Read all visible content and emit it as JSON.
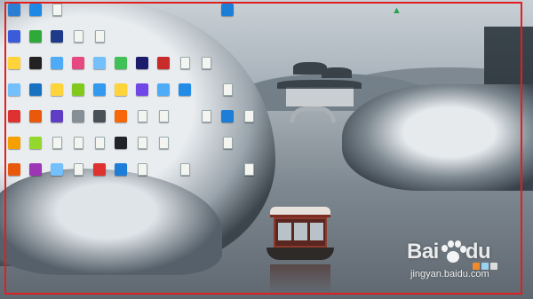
{
  "desktop": {
    "icons": [
      {
        "name": "desktop-icon-1",
        "glyph": "",
        "label": "",
        "color": "#2a7fd4",
        "col": 0,
        "row": 0
      },
      {
        "name": "desktop-icon-2",
        "glyph": "",
        "label": "",
        "color": "#1e88e5",
        "col": 1,
        "row": 0
      },
      {
        "name": "desktop-icon-3",
        "glyph": "",
        "label": "",
        "color": "doc",
        "col": 2,
        "row": 0
      },
      {
        "name": "desktop-icon-4",
        "glyph": "",
        "label": "",
        "color": "#3b5bdb",
        "col": 0,
        "row": 1
      },
      {
        "name": "desktop-icon-5",
        "glyph": "",
        "label": "",
        "color": "#2faa3a",
        "col": 1,
        "row": 1
      },
      {
        "name": "desktop-icon-6",
        "glyph": "",
        "label": "",
        "color": "#1e3a8a",
        "col": 2,
        "row": 1
      },
      {
        "name": "desktop-icon-7",
        "glyph": "",
        "label": "",
        "color": "doc",
        "col": 3,
        "row": 1
      },
      {
        "name": "desktop-icon-8",
        "glyph": "",
        "label": "",
        "color": "doc",
        "col": 4,
        "row": 1
      },
      {
        "name": "desktop-icon-9",
        "glyph": "",
        "label": "",
        "color": "#ffd43b",
        "col": 0,
        "row": 2
      },
      {
        "name": "desktop-icon-10",
        "glyph": "",
        "label": "",
        "color": "#222222",
        "col": 1,
        "row": 2
      },
      {
        "name": "desktop-icon-11",
        "glyph": "",
        "label": "",
        "color": "#4dabf7",
        "col": 2,
        "row": 2
      },
      {
        "name": "desktop-icon-12",
        "glyph": "",
        "label": "",
        "color": "#e64980",
        "col": 3,
        "row": 2
      },
      {
        "name": "desktop-icon-13",
        "glyph": "",
        "label": "",
        "color": "#74c0fc",
        "col": 4,
        "row": 2
      },
      {
        "name": "desktop-icon-14",
        "glyph": "",
        "label": "",
        "color": "#40c057",
        "col": 5,
        "row": 2
      },
      {
        "name": "desktop-icon-15",
        "glyph": "",
        "label": "",
        "color": "#1c1c6b",
        "col": 6,
        "row": 2
      },
      {
        "name": "desktop-icon-16",
        "glyph": "",
        "label": "",
        "color": "#c92a2a",
        "col": 7,
        "row": 2
      },
      {
        "name": "desktop-icon-17",
        "glyph": "",
        "label": "",
        "color": "doc",
        "col": 8,
        "row": 2
      },
      {
        "name": "desktop-icon-18",
        "glyph": "",
        "label": "",
        "color": "doc",
        "col": 9,
        "row": 2
      },
      {
        "name": "desktop-icon-19",
        "glyph": "",
        "label": "",
        "color": "#74c0fc",
        "col": 0,
        "row": 3
      },
      {
        "name": "desktop-icon-20",
        "glyph": "",
        "label": "",
        "color": "#1971c2",
        "col": 1,
        "row": 3
      },
      {
        "name": "desktop-icon-21",
        "glyph": "",
        "label": "",
        "color": "#ffd43b",
        "col": 2,
        "row": 3
      },
      {
        "name": "desktop-icon-22",
        "glyph": "",
        "label": "",
        "color": "#82c91e",
        "col": 3,
        "row": 3
      },
      {
        "name": "desktop-icon-23",
        "glyph": "",
        "label": "",
        "color": "#339af0",
        "col": 4,
        "row": 3
      },
      {
        "name": "desktop-icon-24",
        "glyph": "",
        "label": "",
        "color": "#ffd43b",
        "col": 5,
        "row": 3
      },
      {
        "name": "desktop-icon-25",
        "glyph": "",
        "label": "",
        "color": "#7048e8",
        "col": 6,
        "row": 3
      },
      {
        "name": "desktop-icon-26",
        "glyph": "",
        "label": "",
        "color": "#4dabf7",
        "col": 7,
        "row": 3
      },
      {
        "name": "desktop-icon-27",
        "glyph": "",
        "label": "",
        "color": "#228be6",
        "col": 8,
        "row": 3
      },
      {
        "name": "desktop-icon-28",
        "glyph": "",
        "label": "",
        "color": "doc",
        "col": 10,
        "row": 3
      },
      {
        "name": "desktop-icon-29",
        "glyph": "",
        "label": "",
        "color": "#e03131",
        "col": 0,
        "row": 4
      },
      {
        "name": "desktop-icon-30",
        "glyph": "",
        "label": "",
        "color": "#e8590c",
        "col": 1,
        "row": 4
      },
      {
        "name": "desktop-icon-31",
        "glyph": "",
        "label": "",
        "color": "#5f3dc4",
        "col": 2,
        "row": 4
      },
      {
        "name": "desktop-icon-32",
        "glyph": "",
        "label": "",
        "color": "#868e96",
        "col": 3,
        "row": 4
      },
      {
        "name": "desktop-icon-33",
        "glyph": "",
        "label": "",
        "color": "#495057",
        "col": 4,
        "row": 4
      },
      {
        "name": "desktop-icon-34",
        "glyph": "",
        "label": "",
        "color": "#f76707",
        "col": 5,
        "row": 4
      },
      {
        "name": "desktop-icon-35",
        "glyph": "",
        "label": "",
        "color": "doc",
        "col": 6,
        "row": 4
      },
      {
        "name": "desktop-icon-36",
        "glyph": "",
        "label": "",
        "color": "doc",
        "col": 7,
        "row": 4
      },
      {
        "name": "desktop-icon-37",
        "glyph": "",
        "label": "",
        "color": "doc",
        "col": 9,
        "row": 4
      },
      {
        "name": "desktop-icon-38",
        "glyph": "",
        "label": "",
        "color": "#1c7ed6",
        "col": 10,
        "row": 4
      },
      {
        "name": "desktop-icon-39",
        "glyph": "",
        "label": "",
        "color": "doc",
        "col": 11,
        "row": 4
      },
      {
        "name": "desktop-icon-40",
        "glyph": "",
        "label": "",
        "color": "#f59f00",
        "col": 0,
        "row": 5
      },
      {
        "name": "desktop-icon-41",
        "glyph": "",
        "label": "",
        "color": "#94d82d",
        "col": 1,
        "row": 5
      },
      {
        "name": "desktop-icon-42",
        "glyph": "",
        "label": "",
        "color": "doc",
        "col": 2,
        "row": 5
      },
      {
        "name": "desktop-icon-43",
        "glyph": "",
        "label": "",
        "color": "doc",
        "col": 3,
        "row": 5
      },
      {
        "name": "desktop-icon-44",
        "glyph": "",
        "label": "",
        "color": "doc",
        "col": 4,
        "row": 5
      },
      {
        "name": "desktop-icon-45",
        "glyph": "",
        "label": "",
        "color": "#212529",
        "col": 5,
        "row": 5
      },
      {
        "name": "desktop-icon-46",
        "glyph": "",
        "label": "",
        "color": "doc",
        "col": 6,
        "row": 5
      },
      {
        "name": "desktop-icon-47",
        "glyph": "",
        "label": "",
        "color": "doc",
        "col": 7,
        "row": 5
      },
      {
        "name": "desktop-icon-48",
        "glyph": "",
        "label": "",
        "color": "doc",
        "col": 10,
        "row": 5
      },
      {
        "name": "desktop-icon-49",
        "glyph": "",
        "label": "",
        "color": "#e8590c",
        "col": 0,
        "row": 6
      },
      {
        "name": "desktop-icon-50",
        "glyph": "",
        "label": "",
        "color": "#9c36b5",
        "col": 1,
        "row": 6
      },
      {
        "name": "desktop-icon-51",
        "glyph": "",
        "label": "",
        "color": "#74c0fc",
        "col": 2,
        "row": 6
      },
      {
        "name": "desktop-icon-52",
        "glyph": "",
        "label": "",
        "color": "doc",
        "col": 3,
        "row": 6
      },
      {
        "name": "desktop-icon-53",
        "glyph": "",
        "label": "",
        "color": "#e03131",
        "col": 4,
        "row": 6
      },
      {
        "name": "desktop-icon-54",
        "glyph": "",
        "label": "",
        "color": "#1c7ed6",
        "col": 5,
        "row": 6
      },
      {
        "name": "desktop-icon-55",
        "glyph": "",
        "label": "",
        "color": "doc",
        "col": 6,
        "row": 6
      },
      {
        "name": "desktop-icon-56",
        "glyph": "",
        "label": "",
        "color": "doc",
        "col": 8,
        "row": 6
      },
      {
        "name": "desktop-icon-57",
        "glyph": "",
        "label": "",
        "color": "doc",
        "col": 11,
        "row": 6
      },
      {
        "name": "desktop-icon-58",
        "glyph": "",
        "label": "",
        "color": "#1c7ed6",
        "col": 10,
        "row": 0
      }
    ]
  },
  "watermark": {
    "logo_left": "Bai",
    "logo_right": "du",
    "url": "jingyan.baidu.com",
    "color": "#ffffff"
  },
  "frame_color": "#e02020",
  "ornament_icon": "christmas-tree-icon"
}
